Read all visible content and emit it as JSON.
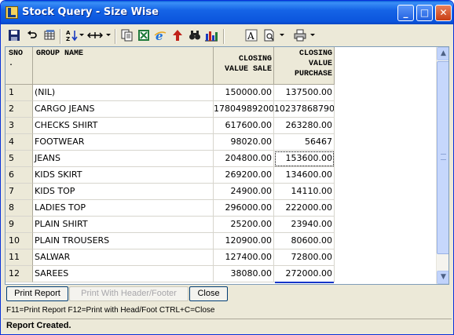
{
  "window": {
    "title": "Stock Query - Size Wise",
    "minimize": "_",
    "maximize": "□",
    "close": "✕"
  },
  "toolbar": {
    "icons": [
      "save-icon",
      "undo-icon",
      "grid-icon",
      "sort-icon",
      "column-width-icon",
      "copy-icon",
      "excel-icon",
      "browser-icon",
      "find-icon",
      "upload-icon",
      "chart-icon",
      "font-icon",
      "preview-icon",
      "print-icon"
    ]
  },
  "grid": {
    "headers": {
      "sno": [
        "SNO",
        "."
      ],
      "name": [
        "GROUP NAME"
      ],
      "sale": [
        "CLOSING",
        "VALUE SALE"
      ],
      "purchase": [
        "CLOSING",
        "VALUE",
        "PURCHASE"
      ]
    },
    "rows": [
      {
        "sno": "1",
        "name": "(NIL)",
        "sale": "150000.00",
        "purchase": "137500.00"
      },
      {
        "sno": "2",
        "name": "CARGO JEANS",
        "sale": "17804989200.",
        "purchase": "10237868790."
      },
      {
        "sno": "3",
        "name": "CHECKS SHIRT",
        "sale": "617600.00",
        "purchase": "263280.00"
      },
      {
        "sno": "4",
        "name": "FOOTWEAR",
        "sale": "98020.00",
        "purchase": "56467"
      },
      {
        "sno": "5",
        "name": "JEANS",
        "sale": "204800.00",
        "purchase": "153600.00"
      },
      {
        "sno": "6",
        "name": "KIDS SKIRT",
        "sale": "269200.00",
        "purchase": "134600.00"
      },
      {
        "sno": "7",
        "name": "KIDS TOP",
        "sale": "24900.00",
        "purchase": "14110.00"
      },
      {
        "sno": "8",
        "name": "LADIES TOP",
        "sale": "296000.00",
        "purchase": "222000.00"
      },
      {
        "sno": "9",
        "name": "PLAIN SHIRT",
        "sale": "25200.00",
        "purchase": "23940.00"
      },
      {
        "sno": "10",
        "name": "PLAIN TROUSERS",
        "sale": "120900.00",
        "purchase": "80600.00"
      },
      {
        "sno": "11",
        "name": "SALWAR",
        "sale": "127400.00",
        "purchase": "72800.00"
      },
      {
        "sno": "12",
        "name": "SAREES",
        "sale": "38080.00",
        "purchase": "272000.00"
      }
    ]
  },
  "buttons": {
    "print_report": "Print Report",
    "print_header_footer": "Print With Header/Footer",
    "close": "Close"
  },
  "hint": "F11=Print Report  F12=Print with Head/Foot  CTRL+C=Close",
  "status": "Report Created."
}
